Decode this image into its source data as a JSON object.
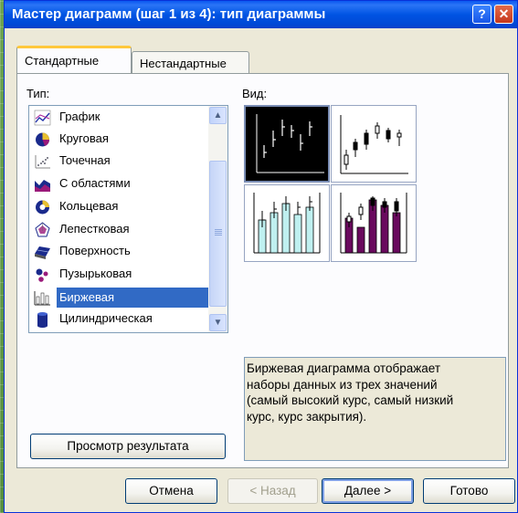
{
  "window": {
    "title": "Мастер диаграмм (шаг 1 из 4): тип диаграммы",
    "help_label": "?",
    "close_label": "✕"
  },
  "tabs": [
    {
      "label": "Стандартные"
    },
    {
      "label": "Нестандартные"
    }
  ],
  "type_label": "Тип:",
  "view_label": "Вид:",
  "chart_types": [
    {
      "label": "График",
      "icon": "line-chart-icon"
    },
    {
      "label": "Круговая",
      "icon": "pie-chart-icon"
    },
    {
      "label": "Точечная",
      "icon": "scatter-chart-icon"
    },
    {
      "label": "С областями",
      "icon": "area-chart-icon"
    },
    {
      "label": "Кольцевая",
      "icon": "doughnut-chart-icon"
    },
    {
      "label": "Лепестковая",
      "icon": "radar-chart-icon"
    },
    {
      "label": "Поверхность",
      "icon": "surface-chart-icon"
    },
    {
      "label": "Пузырьковая",
      "icon": "bubble-chart-icon"
    },
    {
      "label": "Биржевая",
      "icon": "stock-chart-icon",
      "selected": true
    },
    {
      "label": "Цилиндрическая",
      "icon": "cylinder-chart-icon"
    }
  ],
  "scroll": {
    "up": "▲",
    "down": "▼"
  },
  "description": [
    "Биржевая диаграмма отображает",
    "наборы данных из трех значений",
    "(самый высокий курс, самый низкий",
    "курс, курс закрытия)."
  ],
  "preview_button": "Просмотр результата",
  "buttons": {
    "cancel": "Отмена",
    "back": "< Назад",
    "next": "Далее >",
    "done": "Готово"
  },
  "colors": {
    "selection": "#316ac5",
    "subtype_bar_light": "#bff0f0",
    "subtype_bar_dark": "#6a0a5e"
  }
}
